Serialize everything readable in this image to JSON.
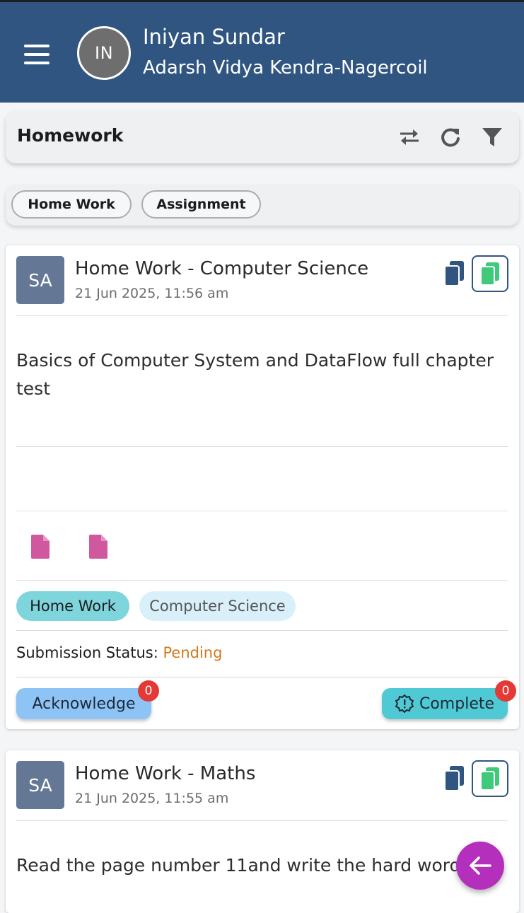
{
  "header": {
    "avatar_initials": "IN",
    "user_name": "Iniyan Sundar",
    "school": "Adarsh Vidya Kendra-Nagercoil"
  },
  "toolbar": {
    "title": "Homework",
    "icons": [
      "swap-icon",
      "refresh-icon",
      "filter-icon"
    ]
  },
  "tabs": [
    {
      "label": "Home Work"
    },
    {
      "label": "Assignment"
    }
  ],
  "cards": [
    {
      "avatar": "SA",
      "title": "Home Work - Computer Science",
      "date": "21 Jun 2025, 11:56 am",
      "description": "Basics of Computer System and DataFlow full chapter test",
      "attachments": 2,
      "chips": [
        "Home Work",
        "Computer Science"
      ],
      "status_label": "Submission Status: ",
      "status_value": "Pending",
      "acknowledge_label": "Acknowledge",
      "acknowledge_count": "0",
      "complete_label": "Complete",
      "complete_count": "0"
    },
    {
      "avatar": "SA",
      "title": "Home Work - Maths",
      "date": "21 Jun 2025, 11:55 am",
      "description": "Read the page number 11and write the hard words"
    }
  ],
  "colors": {
    "header_bg": "#2f5580",
    "status_pending": "#d4781c",
    "acknowledge_bg": "#8ec4f5",
    "complete_bg": "#4fc9d4",
    "badge": "#e53935",
    "fab": "#b52fbd",
    "file_icon": "#d0589f"
  },
  "fab": {
    "icon": "arrow-left-icon"
  }
}
